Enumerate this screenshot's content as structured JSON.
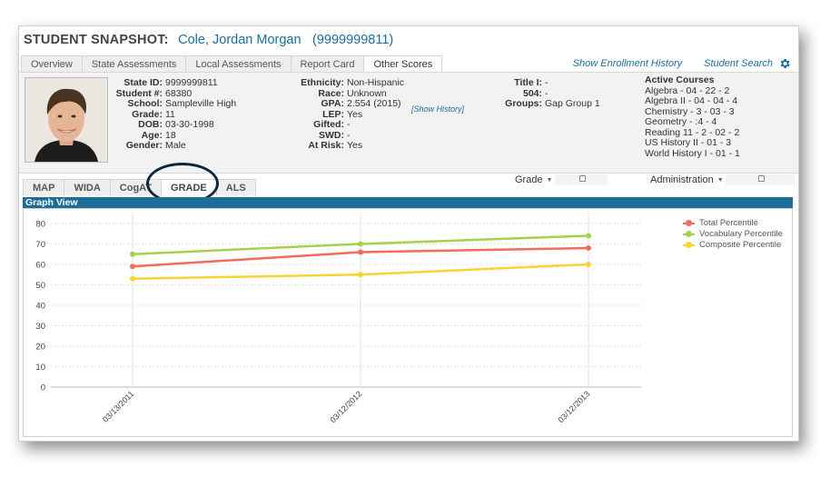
{
  "header": {
    "label": "STUDENT SNAPSHOT:",
    "student_name": "Cole, Jordan Morgan",
    "student_id": "(9999999811)"
  },
  "tabs": [
    {
      "label": "Overview"
    },
    {
      "label": "State Assessments"
    },
    {
      "label": "Local Assessments"
    },
    {
      "label": "Report Card"
    },
    {
      "label": "Other Scores"
    }
  ],
  "links": {
    "enrollment_history": "Show Enrollment History",
    "student_search": "Student Search"
  },
  "student": {
    "col1": [
      {
        "label": "State ID:",
        "value": "9999999811"
      },
      {
        "label": "Student #:",
        "value": "68380"
      },
      {
        "label": "School:",
        "value": "Sampleville High"
      },
      {
        "label": "Grade:",
        "value": "11"
      },
      {
        "label": "DOB:",
        "value": "03-30-1998"
      },
      {
        "label": "Age:",
        "value": "18"
      },
      {
        "label": "Gender:",
        "value": "Male"
      }
    ],
    "col2": [
      {
        "label": "Ethnicity:",
        "value": "Non-Hispanic"
      },
      {
        "label": "Race:",
        "value": "Unknown"
      },
      {
        "label": "GPA:",
        "value": "2.554 (2015)"
      },
      {
        "label": "LEP:",
        "value": "Yes"
      },
      {
        "label": "Gifted:",
        "value": "-"
      },
      {
        "label": "SWD:",
        "value": "-"
      },
      {
        "label": "At Risk:",
        "value": "Yes"
      }
    ],
    "show_history": "[Show History]",
    "col3": [
      {
        "label": "Title I:",
        "value": "-"
      },
      {
        "label": "504:",
        "value": "-"
      },
      {
        "label": "Groups:",
        "value": "Gap Group 1"
      }
    ],
    "active_courses_title": "Active Courses",
    "active_courses": [
      "Algebra - 04 - 22 - 2",
      "Algebra II - 04 - 04 - 4",
      "Chemistry - 3 - 03 - 3",
      "Geometry - :4 - 4",
      "Reading 11 - 2 - 02 - 2",
      "US History II - 01 - 3",
      "World History I - 01 - 1"
    ]
  },
  "subtabs": [
    {
      "label": "MAP"
    },
    {
      "label": "WIDA"
    },
    {
      "label": "CogAT"
    },
    {
      "label": "GRADE"
    },
    {
      "label": "ALS"
    }
  ],
  "filters": {
    "grade_label": "Grade",
    "administration_label": "Administration"
  },
  "graph": {
    "title": "Graph View"
  },
  "colors": {
    "total": "#f26b5b",
    "vocabulary": "#a8d04a",
    "composite": "#f7d530",
    "header_blue": "#1a6e9a"
  },
  "chart_data": {
    "type": "line",
    "x": [
      "03/13/2011",
      "03/12/2012",
      "03/12/2013"
    ],
    "series": [
      {
        "name": "Total Percentile",
        "values": [
          59,
          66,
          68
        ]
      },
      {
        "name": "Vocabulary Percentile",
        "values": [
          65,
          70,
          74
        ]
      },
      {
        "name": "Composite Percentile",
        "values": [
          53,
          55,
          60
        ]
      }
    ],
    "yticks": [
      0,
      10,
      20,
      30,
      40,
      50,
      60,
      70,
      80
    ],
    "ylim": [
      0,
      80
    ],
    "grid": true,
    "legend": "top-right"
  }
}
